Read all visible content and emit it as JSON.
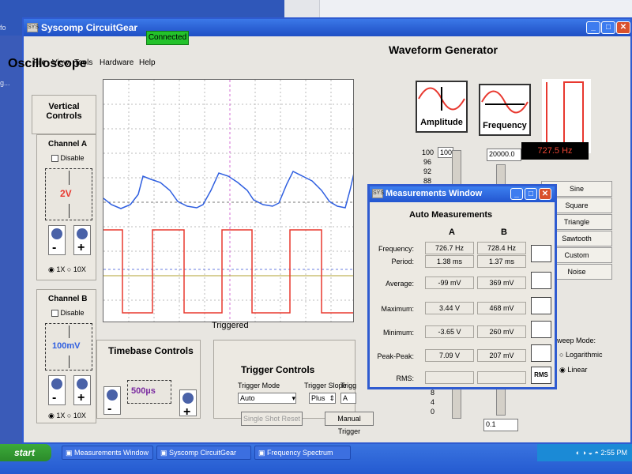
{
  "window": {
    "title": "Syscomp CircuitGear"
  },
  "menu": {
    "items": [
      "File",
      "View",
      "Tools",
      "Hardware",
      "Help"
    ],
    "connected": "Connected"
  },
  "oscilloscope": {
    "title": "Oscilloscope",
    "vertical_controls": "Vertical Controls",
    "channel_a": {
      "label": "Channel A",
      "disable": "Disable",
      "scale": "2V",
      "opt1": "1X",
      "opt2": "10X"
    },
    "channel_b": {
      "label": "Channel B",
      "disable": "Disable",
      "scale": "100mV",
      "opt1": "1X",
      "opt2": "10X"
    },
    "status": "Triggered"
  },
  "timebase": {
    "title": "Timebase Controls",
    "value": "500µs"
  },
  "trigger": {
    "title": "Trigger Controls",
    "mode_label": "Trigger Mode",
    "mode_value": "Auto",
    "slope_label": "Trigger Slope",
    "slope_value": "Plus",
    "source_label": "Trigg",
    "source_value": "A",
    "single_shot": "Single Shot Reset",
    "manual": "Manual Trigger"
  },
  "waveform_generator": {
    "title": "Waveform Generator",
    "amplitude_label": "Amplitude",
    "frequency_label": "Frequency",
    "amp_value": "100",
    "amp_ticks": [
      "100",
      "96",
      "92",
      "88"
    ],
    "freq_value": "20000.0",
    "freq_display": "727.5 Hz",
    "waves": [
      "Sine",
      "Square",
      "Triangle",
      "Sawtooth",
      "Custom",
      "Noise"
    ],
    "sweep_mode": "weep Mode:",
    "sweep_opts": [
      "Logarithmic",
      "Linear"
    ],
    "low_ticks": [
      "8",
      "4",
      "0"
    ],
    "low_value": "0.1"
  },
  "measurements": {
    "title": "Measurements Window",
    "heading": "Auto Measurements",
    "col_a": "A",
    "col_b": "B",
    "rows": [
      {
        "label": "Frequency:",
        "a": "726.7 Hz",
        "b": "728.4 Hz"
      },
      {
        "label": "Period:",
        "a": "1.38 ms",
        "b": "1.37 ms"
      },
      {
        "label": "Average:",
        "a": "-99 mV",
        "b": "369 mV"
      },
      {
        "label": "Maximum:",
        "a": "3.44 V",
        "b": "468 mV"
      },
      {
        "label": "Minimum:",
        "a": "-3.65 V",
        "b": "260 mV"
      },
      {
        "label": "Peak-Peak:",
        "a": "7.09 V",
        "b": "207 mV"
      },
      {
        "label": "RMS:",
        "a": "",
        "b": ""
      }
    ],
    "rms_icon": "RMS"
  },
  "taskbar": {
    "start": "start",
    "tasks": [
      "Measurements Window",
      "Syscomp CircuitGear",
      "Frequency Spectrum"
    ],
    "clock": "2:55 PM"
  },
  "desktop": {
    "left_labels": [
      "fo",
      "g..."
    ]
  },
  "colors": {
    "channel_a": "#e8382f",
    "channel_b": "#2f5fe0",
    "accent": "#2f5bd0"
  }
}
